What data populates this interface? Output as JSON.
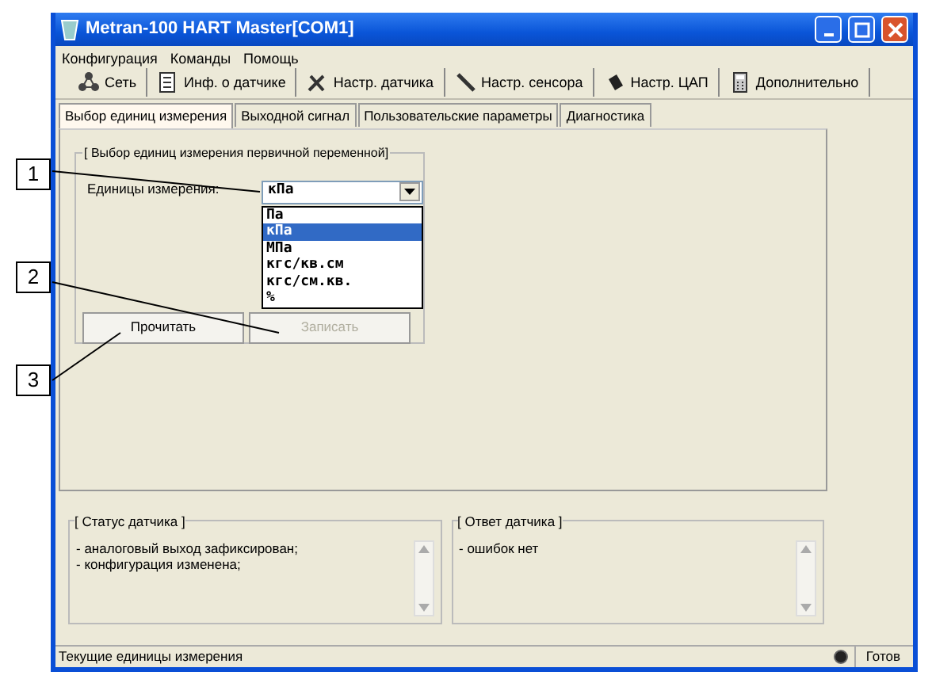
{
  "window": {
    "title": "Metran-100 HART Master[COM1]"
  },
  "menu": [
    "Конфигурация",
    "Команды",
    "Помощь"
  ],
  "toolbar": [
    {
      "label": "Сеть"
    },
    {
      "label": "Инф. о датчике"
    },
    {
      "label": "Настр. датчика"
    },
    {
      "label": "Настр. сенсора"
    },
    {
      "label": "Настр. ЦАП"
    },
    {
      "label": "Дополнительно"
    }
  ],
  "subtabs": [
    {
      "label": "Выбор единиц измерения",
      "selected": true
    },
    {
      "label": "Выходной сигнал",
      "selected": false
    },
    {
      "label": "Пользовательские параметры",
      "selected": false
    },
    {
      "label": "Диагностика",
      "selected": false
    }
  ],
  "group": {
    "title": "[ Выбор единиц измерения  первичной переменной]",
    "field_label": "Единицы измерения:",
    "dropdown": {
      "value": "кПа",
      "options": [
        {
          "label": "Па",
          "selected": false
        },
        {
          "label": "кПа",
          "selected": true
        },
        {
          "label": "МПа",
          "selected": false
        },
        {
          "label": "кгс/кв.см",
          "selected": false
        },
        {
          "label": "кгс/см.кв.",
          "selected": false
        },
        {
          "label": "%",
          "selected": false
        }
      ]
    }
  },
  "buttons": [
    {
      "label": "Прочитать",
      "disabled": false
    },
    {
      "label": "Записать",
      "disabled": true
    }
  ],
  "status_panels": [
    {
      "title": "[ Статус датчика ]",
      "lines": [
        "- аналоговый выход зафиксирован;",
        "- конфигурация изменена;"
      ]
    },
    {
      "title": "[ Ответ датчика ]",
      "lines": [
        "- ошибок нет"
      ]
    }
  ],
  "status_bar": {
    "text": "Текущие единицы измерения",
    "state": "Готов"
  },
  "callouts": [
    "1",
    "2",
    "3"
  ]
}
